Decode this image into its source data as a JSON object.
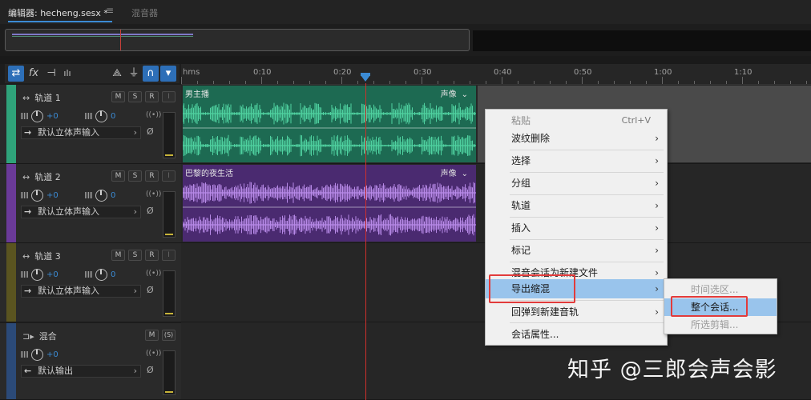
{
  "tabs": {
    "editor_label": "编辑器: hecheng.sesx *",
    "menu_glyph": "≡",
    "mixer_label": "混音器"
  },
  "toolbar": {
    "swap_glyph": "⇄",
    "fx_glyph": "fx",
    "routing_glyph": "⊣",
    "meters_glyph": "ılı",
    "metronome_glyph": "⟁",
    "snap_glyph": "⏚",
    "magnet_glyph": "∩",
    "pin_glyph": "▾"
  },
  "ruler": {
    "labels": [
      "hms",
      "0:10",
      "0:20",
      "0:30",
      "0:40",
      "0:50",
      "1:00",
      "1:10"
    ]
  },
  "tracks": [
    {
      "name": "轨道 1",
      "name_glyph": "↔",
      "color": "#2fa37a",
      "m": "M",
      "s": "S",
      "r": "R",
      "i": "I",
      "volume": "+0",
      "pan": "0",
      "pan_right": "((•))",
      "input": "默认立体声输入",
      "input_glyph": "→",
      "null_glyph": "Ø",
      "chev": "›",
      "clip_name": "男主播",
      "clip_tag": "声像",
      "clip_color": "#1d6a52",
      "wave_color": "#4fd1a0"
    },
    {
      "name": "轨道 2",
      "name_glyph": "↔",
      "color": "#6a3a98",
      "m": "M",
      "s": "S",
      "r": "R",
      "i": "I",
      "volume": "+0",
      "pan": "0",
      "pan_right": "((•))",
      "input": "默认立体声输入",
      "input_glyph": "→",
      "null_glyph": "Ø",
      "chev": "›",
      "clip_name": "巴黎的夜生活",
      "clip_tag": "声像",
      "clip_color": "#4a2a70",
      "wave_color": "#b88ae8"
    },
    {
      "name": "轨道 3",
      "name_glyph": "↔",
      "color": "#5a5420",
      "m": "M",
      "s": "S",
      "r": "R",
      "i": "I",
      "volume": "+0",
      "pan": "0",
      "pan_right": "((•))",
      "input": "默认立体声输入",
      "input_glyph": "→",
      "null_glyph": "Ø",
      "chev": "›"
    }
  ],
  "master": {
    "name": "混合",
    "name_glyph": "⊐▸",
    "color": "#2b4a78",
    "m": "M",
    "s": "(S)",
    "volume": "+0",
    "pan_right": "((•))",
    "output": "默认输出",
    "output_glyph": "←",
    "null_glyph": "Ø",
    "chev": "›"
  },
  "context_menu": {
    "items": [
      {
        "label": "粘贴",
        "shortcut": "Ctrl+V",
        "disabled": true
      },
      {
        "label": "波纹删除",
        "sub": "›"
      },
      {
        "label": "选择",
        "sub": "›"
      },
      {
        "label": "分组",
        "sub": "›"
      },
      {
        "label": "轨道",
        "sub": "›"
      },
      {
        "label": "插入",
        "sub": "›"
      },
      {
        "label": "标记",
        "sub": "›"
      },
      {
        "label": "混音会话为新建文件",
        "sub": "›"
      },
      {
        "label": "导出缩混",
        "sub": "›",
        "highlighted": true
      },
      {
        "label": "回弹到新建音轨",
        "sub": "›"
      },
      {
        "label": "会话属性..."
      }
    ]
  },
  "submenu": {
    "items": [
      {
        "label": "时间选区...",
        "disabled": true
      },
      {
        "label": "整个会话...",
        "highlighted": true
      },
      {
        "label": "所选剪辑...",
        "disabled": true
      }
    ]
  },
  "watermark": "知乎 @三郎会声会影",
  "colors": {
    "accent": "#3b8bd4",
    "playhead": "#d0302c",
    "highlight": "#99c4ec",
    "annotation": "#e23b3b"
  }
}
